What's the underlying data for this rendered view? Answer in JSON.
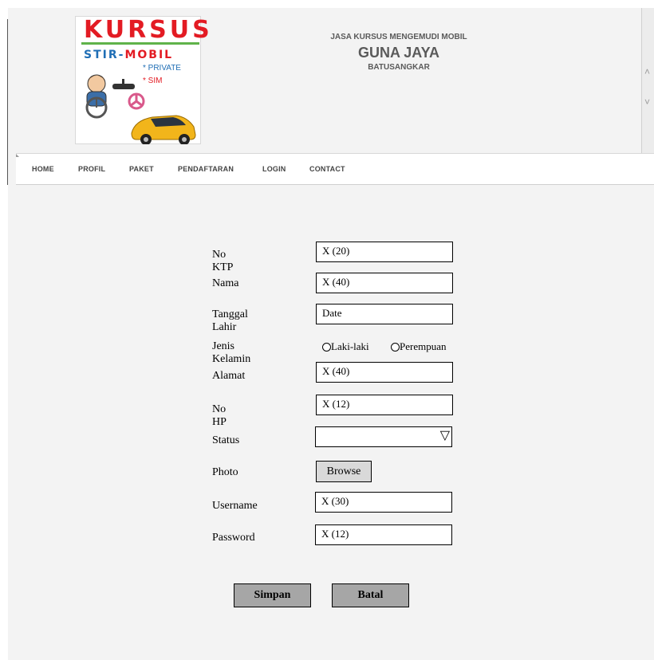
{
  "header": {
    "logo": {
      "title": "KURSUS",
      "subtitle_a": "STIR-",
      "subtitle_b": "MOBIL",
      "line1": "* PRIVATE",
      "line2": "* SIM"
    },
    "tagline": "JASA KURSUS MENGEMUDI MOBIL",
    "name": "GUNA JAYA",
    "city": "BATUSANGKAR"
  },
  "nav": {
    "items": [
      "HOME",
      "PROFIL",
      "PAKET",
      "PENDAFTARAN",
      "LOGIN",
      "CONTACT"
    ]
  },
  "form": {
    "fields": [
      {
        "label": "No KTP",
        "value": "X (20)"
      },
      {
        "label": "Nama",
        "value": "X (40)"
      },
      {
        "label": "Tanggal Lahir",
        "value": "Date"
      },
      {
        "label": "Jenis Kelamin",
        "options": [
          "Laki-laki",
          "Perempuan"
        ]
      },
      {
        "label": "Alamat",
        "value": "X (40)"
      },
      {
        "label": "No HP",
        "value": "X (12)"
      },
      {
        "label": "Status",
        "value": ""
      },
      {
        "label": "Photo",
        "button": "Browse"
      },
      {
        "label": "Username",
        "value": "X (30)"
      },
      {
        "label": "Password",
        "value": "X (12)"
      }
    ],
    "submit_label": "Simpan",
    "cancel_label": "Batal"
  },
  "colors": {
    "brand_red": "#e31b23",
    "brand_blue": "#1f6eb5",
    "brand_green": "#5fb34a",
    "page_bg": "#f3f3f3",
    "button_gray": "#a6a6a6"
  },
  "icons": [
    "driver-illustration",
    "car-illustration",
    "steering-wheel-icon",
    "chevron-up-icon",
    "chevron-down-icon",
    "select-triangle-icon"
  ]
}
